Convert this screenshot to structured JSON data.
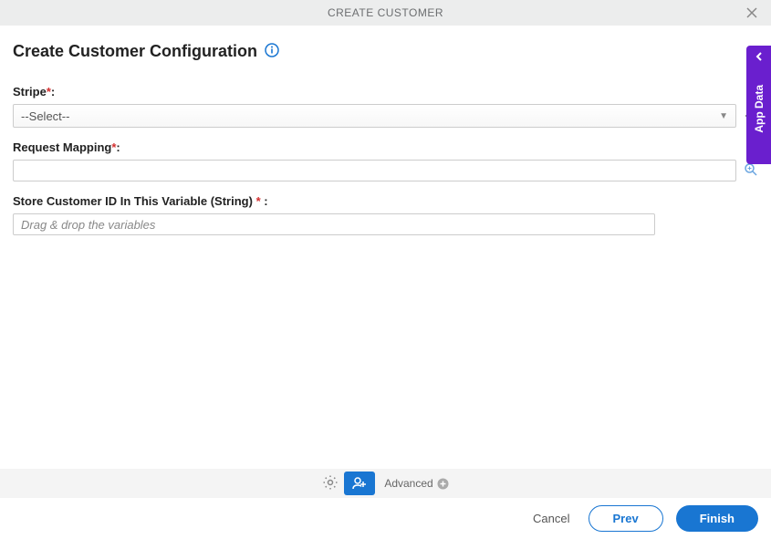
{
  "header": {
    "title": "CREATE CUSTOMER"
  },
  "page": {
    "title": "Create Customer Configuration"
  },
  "fields": {
    "stripe": {
      "label": "Stripe",
      "selected": "--Select--"
    },
    "requestMapping": {
      "label": "Request Mapping",
      "value": ""
    },
    "storeCustomerId": {
      "label": "Store Customer ID In This Variable (String)",
      "placeholder": "Drag & drop the variables",
      "value": ""
    }
  },
  "sideTab": {
    "label": "App Data"
  },
  "toolbar": {
    "advanced_label": "Advanced"
  },
  "footer": {
    "cancel": "Cancel",
    "prev": "Prev",
    "finish": "Finish"
  },
  "colors": {
    "primary": "#1976d2",
    "accent": "#6a1fce",
    "required": "#d32f2f"
  }
}
